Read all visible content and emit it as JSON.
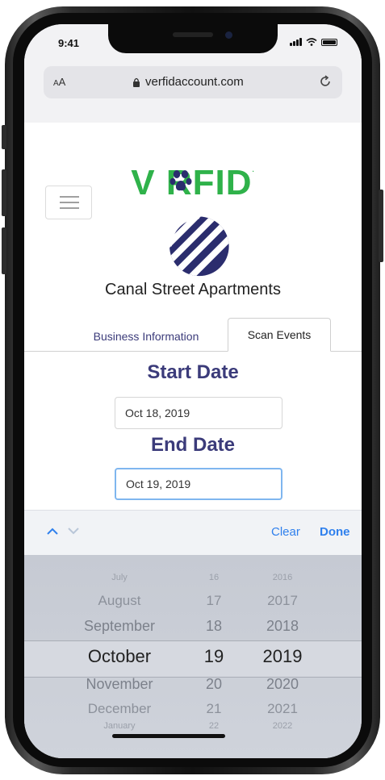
{
  "status_bar": {
    "time": "9:41"
  },
  "browser": {
    "text_size_label_small": "A",
    "text_size_label_large": "A",
    "url": "verfidaccount.com"
  },
  "brand": {
    "name": "V  RFID",
    "mark": "."
  },
  "business": {
    "name": "Canal Street Apartments"
  },
  "tabs": [
    {
      "label": "Business Information"
    },
    {
      "label": "Scan Events"
    }
  ],
  "form": {
    "start_label": "Start Date",
    "start_value": "Oct 18, 2019",
    "end_label": "End Date",
    "end_value": "Oct 19, 2019"
  },
  "keyboard_toolbar": {
    "clear_label": "Clear",
    "done_label": "Done"
  },
  "picker": {
    "months": [
      "July",
      "August",
      "September",
      "October",
      "November",
      "December",
      "January"
    ],
    "days": [
      "16",
      "17",
      "18",
      "19",
      "20",
      "21",
      "22"
    ],
    "years": [
      "2016",
      "2017",
      "2018",
      "2019",
      "2020",
      "2021",
      "2022"
    ],
    "selected": {
      "month": "October",
      "day": "19",
      "year": "2019"
    }
  },
  "colors": {
    "brand_green": "#2fb24a",
    "brand_navy": "#2b2d6e",
    "label_purple": "#3b3b7a",
    "link_blue": "#2f80ed"
  }
}
